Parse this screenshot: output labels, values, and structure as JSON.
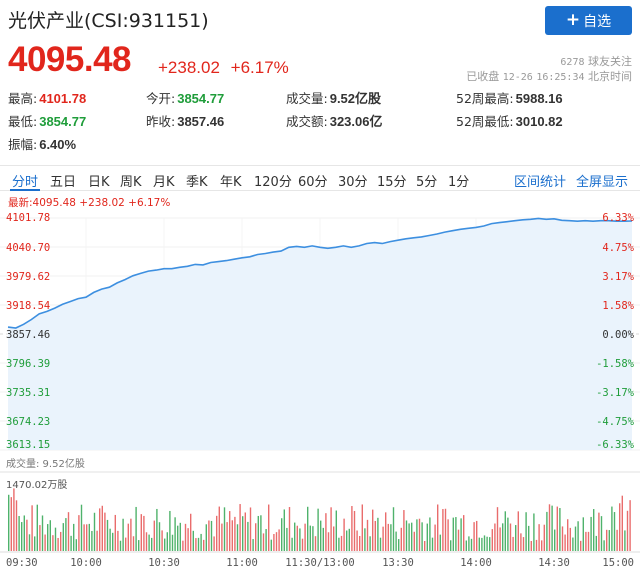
{
  "header": {
    "title": "光伏产业(CSI:931151)",
    "fav_label": "自选",
    "price": "4095.48",
    "change": "+238.02",
    "change_pct": "+6.17%",
    "followers_count": "6278",
    "followers_label": "球友关注",
    "status": "已收盘",
    "date": "12-26",
    "time": "16:25:34",
    "timezone": "北京时间"
  },
  "stats": [
    {
      "label": "最高:",
      "value": "4101.78",
      "color": "red"
    },
    {
      "label": "今开:",
      "value": "3854.77",
      "color": "green"
    },
    {
      "label": "成交量:",
      "value": "9.52亿股",
      "color": "dark"
    },
    {
      "label": "52周最高:",
      "value": "5988.16",
      "color": "dark"
    },
    {
      "label": "最低:",
      "value": "3854.77",
      "color": "green"
    },
    {
      "label": "昨收:",
      "value": "3857.46",
      "color": "dark"
    },
    {
      "label": "成交额:",
      "value": "323.06亿",
      "color": "dark"
    },
    {
      "label": "52周最低:",
      "value": "3010.82",
      "color": "dark"
    },
    {
      "label": "振幅:",
      "value": "6.40%",
      "color": "dark"
    }
  ],
  "tabs": [
    "分时",
    "五日",
    "日K",
    "周K",
    "月K",
    "季K",
    "年K",
    "120分",
    "60分",
    "30分",
    "15分",
    "5分",
    "1分"
  ],
  "tabs_right": [
    "区间统计",
    "全屏显示"
  ],
  "latest_line": "最新:4095.48 +238.02 +6.17%",
  "watermark": "雪球",
  "colors": {
    "up": "#e1261c",
    "down": "#1f9d3a",
    "accent": "#1b6fcd",
    "line": "#3d8fe0",
    "fill": "#eaf3fc"
  },
  "chart_data": {
    "type": "area",
    "y_ticks_left": [
      "4101.78",
      "4040.70",
      "3979.62",
      "3918.54",
      "3857.46",
      "3796.39",
      "3735.31",
      "3674.23",
      "3613.15"
    ],
    "y_ticks_right": [
      "6.33%",
      "4.75%",
      "3.17%",
      "1.58%",
      "0.00%",
      "-1.58%",
      "-3.17%",
      "-4.75%",
      "-6.33%"
    ],
    "ylim": [
      3613.15,
      4101.78
    ],
    "x_ticks": [
      "09:30",
      "10:00",
      "10:30",
      "11:00",
      "11:30/13:00",
      "13:30",
      "14:00",
      "14:30",
      "15:00"
    ],
    "volume_label": "成交量: 9.52亿股",
    "volume_max_label": "1470.02万股",
    "price_series": [
      [
        0,
        3872
      ],
      [
        3,
        3870
      ],
      [
        6,
        3878
      ],
      [
        9,
        3888
      ],
      [
        12,
        3900
      ],
      [
        15,
        3905
      ],
      [
        18,
        3912
      ],
      [
        21,
        3920
      ],
      [
        24,
        3926
      ],
      [
        27,
        3932
      ],
      [
        30,
        3935
      ],
      [
        33,
        3945
      ],
      [
        36,
        3952
      ],
      [
        39,
        3956
      ],
      [
        42,
        3965
      ],
      [
        45,
        3972
      ],
      [
        48,
        3980
      ],
      [
        51,
        3985
      ],
      [
        54,
        3990
      ],
      [
        57,
        3992
      ],
      [
        60,
        3995
      ],
      [
        63,
        3995
      ],
      [
        66,
        3998
      ],
      [
        69,
        4000
      ],
      [
        72,
        4004
      ],
      [
        75,
        4003
      ],
      [
        78,
        4008
      ],
      [
        81,
        4010
      ],
      [
        84,
        4012
      ],
      [
        87,
        4015
      ],
      [
        90,
        4018
      ],
      [
        93,
        4020
      ],
      [
        96,
        4025
      ],
      [
        99,
        4027
      ],
      [
        102,
        4030
      ],
      [
        105,
        4032
      ],
      [
        108,
        4040
      ],
      [
        111,
        4042
      ],
      [
        114,
        4040
      ],
      [
        117,
        4043
      ],
      [
        120,
        4040
      ],
      [
        123,
        4038
      ],
      [
        126,
        4040
      ],
      [
        129,
        4043
      ],
      [
        132,
        4040
      ],
      [
        135,
        4043
      ],
      [
        138,
        4048
      ],
      [
        141,
        4050
      ],
      [
        144,
        4048
      ],
      [
        147,
        4052
      ],
      [
        150,
        4055
      ],
      [
        153,
        4058
      ],
      [
        156,
        4060
      ],
      [
        159,
        4062
      ],
      [
        162,
        4065
      ],
      [
        165,
        4068
      ],
      [
        168,
        4072
      ],
      [
        171,
        4075
      ],
      [
        174,
        4078
      ],
      [
        177,
        4080
      ],
      [
        180,
        4082
      ],
      [
        183,
        4085
      ],
      [
        186,
        4090
      ],
      [
        189,
        4092
      ],
      [
        192,
        4094
      ],
      [
        195,
        4096
      ],
      [
        198,
        4098
      ],
      [
        201,
        4099
      ],
      [
        204,
        4101
      ],
      [
        207,
        4099
      ],
      [
        210,
        4100
      ],
      [
        213,
        4097
      ],
      [
        216,
        4096
      ],
      [
        219,
        4095
      ],
      [
        222,
        4096
      ],
      [
        225,
        4095
      ],
      [
        228,
        4096
      ],
      [
        231,
        4096
      ],
      [
        234,
        4095
      ],
      [
        237,
        4095
      ],
      [
        240,
        4095.48
      ]
    ]
  }
}
